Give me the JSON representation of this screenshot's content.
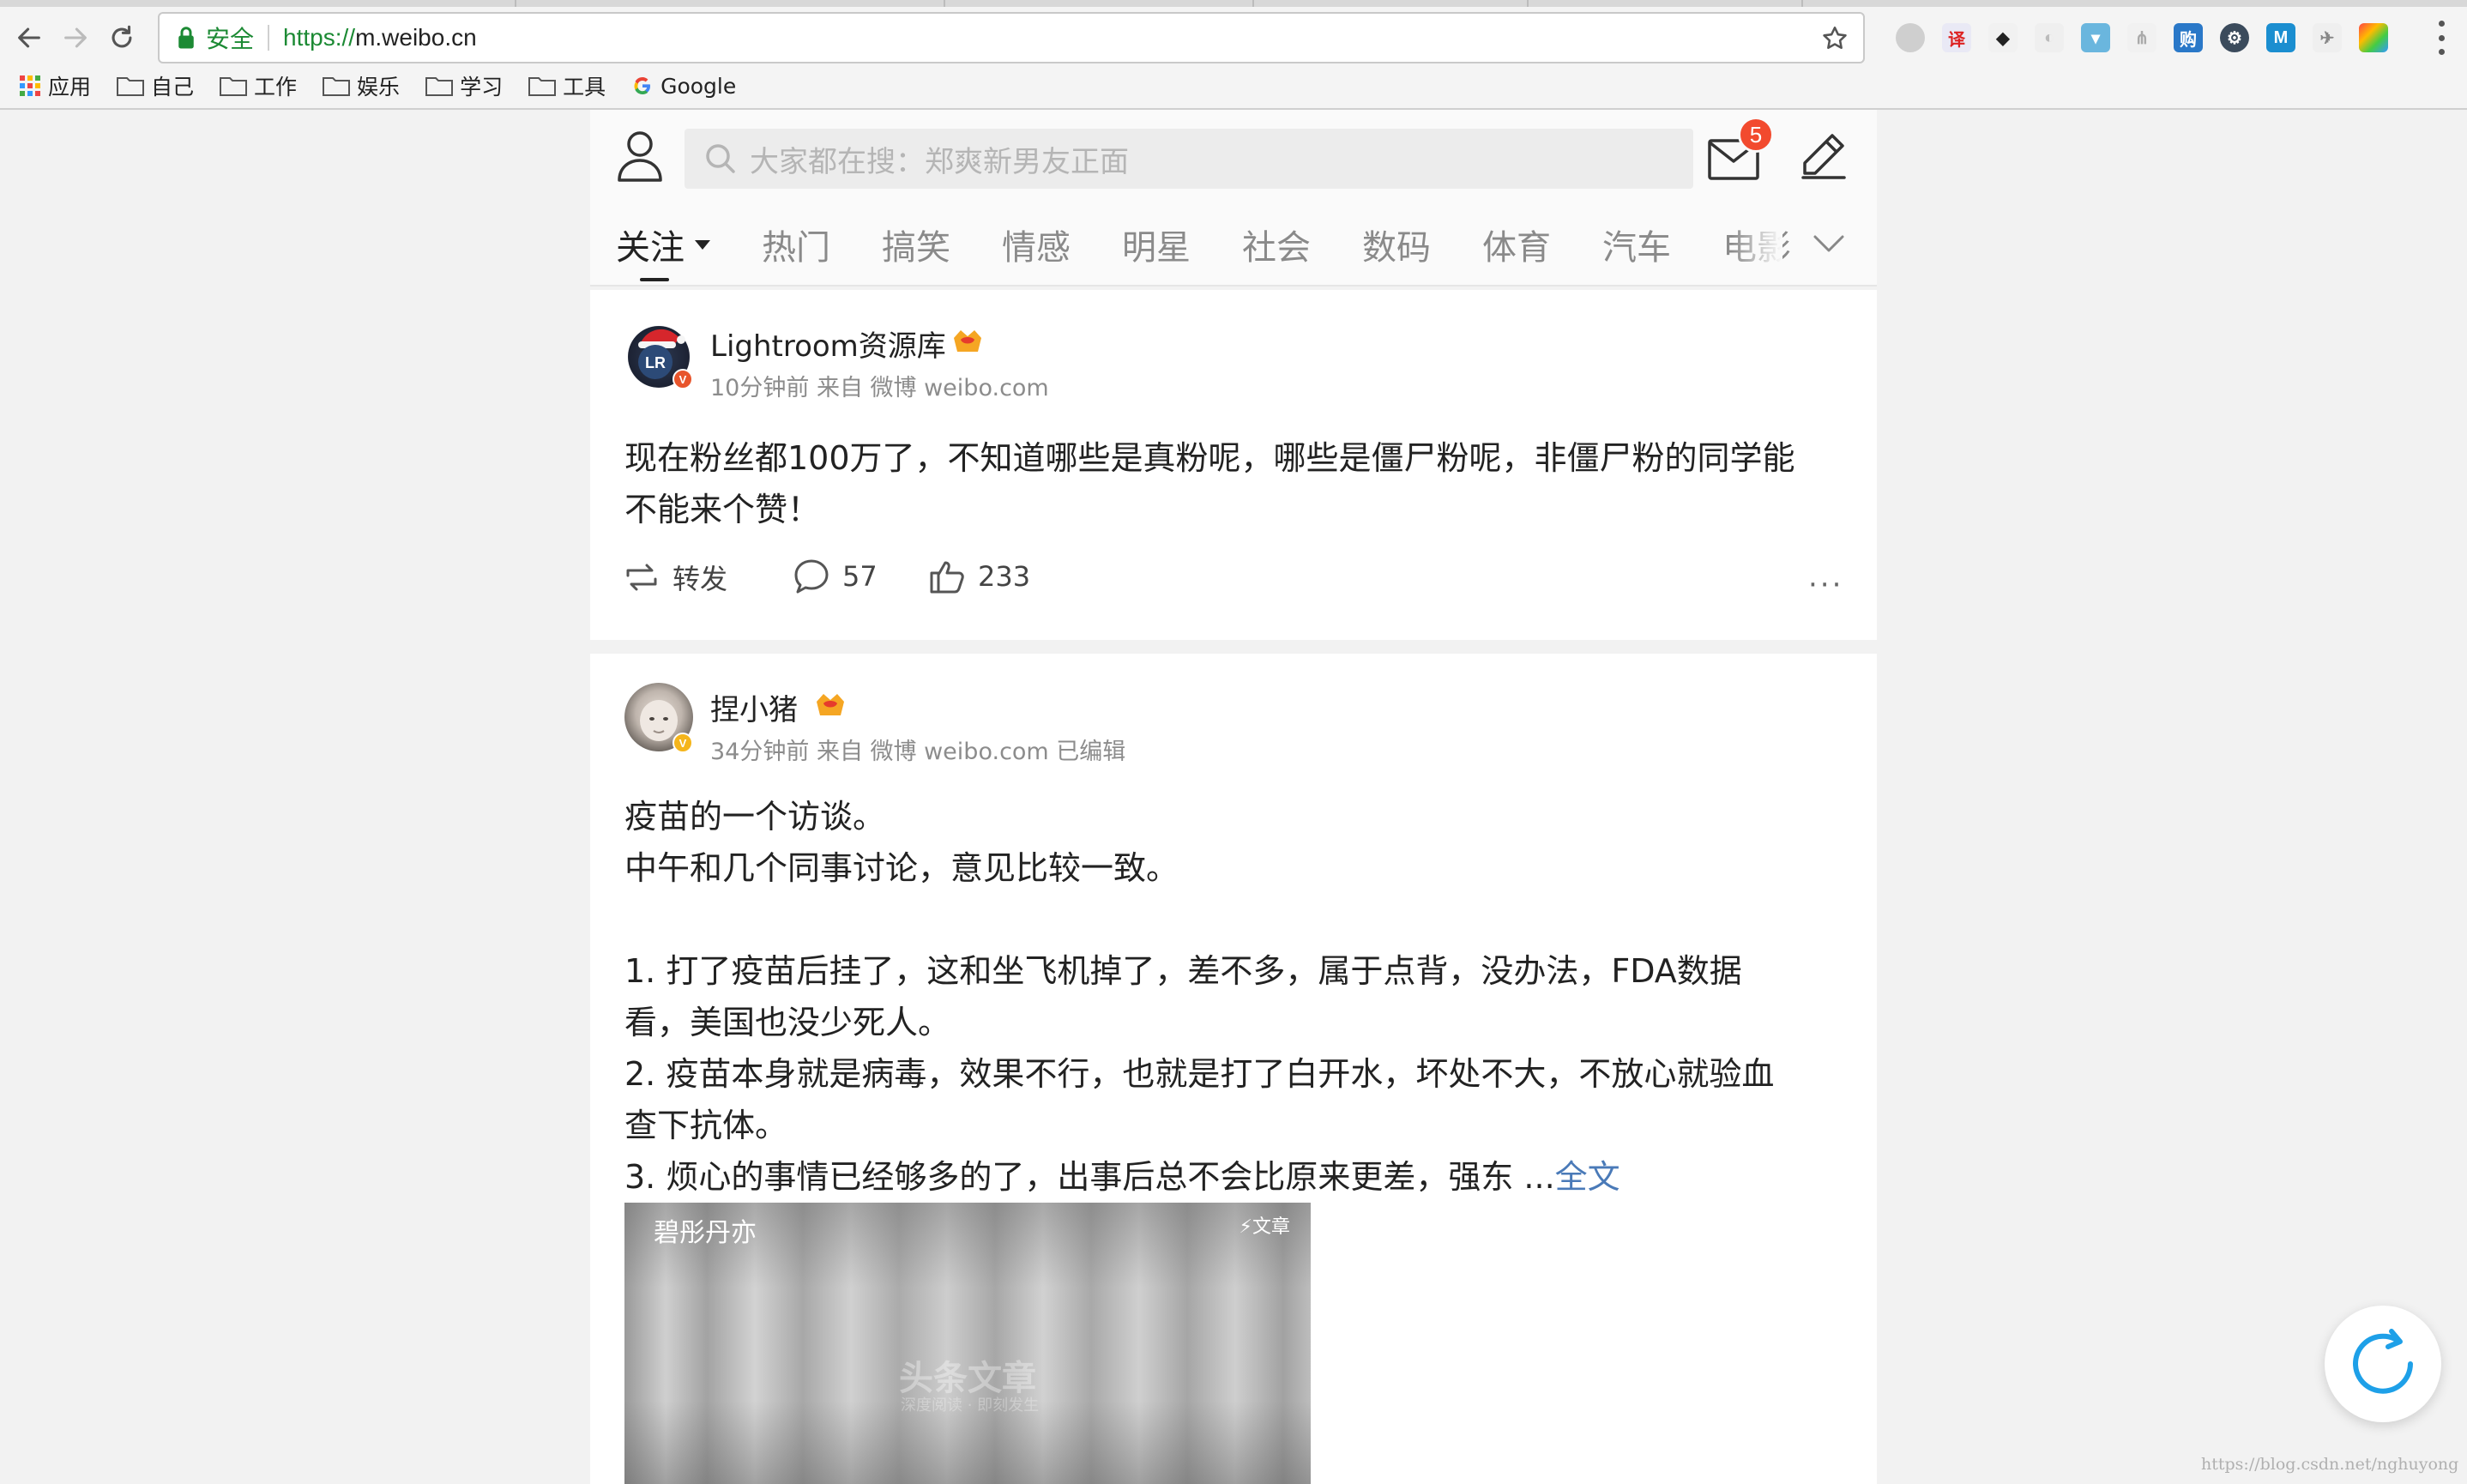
{
  "browser": {
    "secure_label": "安全",
    "url_scheme": "https://",
    "url_host": "m.weibo.cn",
    "bookmarks": [
      {
        "label": "应用",
        "icon": "apps-grid-icon"
      },
      {
        "label": "自己",
        "icon": "folder-icon"
      },
      {
        "label": "工作",
        "icon": "folder-icon"
      },
      {
        "label": "娱乐",
        "icon": "folder-icon"
      },
      {
        "label": "学习",
        "icon": "folder-icon"
      },
      {
        "label": "工具",
        "icon": "folder-icon"
      },
      {
        "label": "Google",
        "icon": "google-g-icon"
      }
    ]
  },
  "header": {
    "search_placeholder": "大家都在搜：郑爽新男友正面",
    "mail_badge": "5"
  },
  "tabs": [
    {
      "label": "关注",
      "active": true
    },
    {
      "label": "热门"
    },
    {
      "label": "搞笑"
    },
    {
      "label": "情感"
    },
    {
      "label": "明星"
    },
    {
      "label": "社会"
    },
    {
      "label": "数码"
    },
    {
      "label": "体育"
    },
    {
      "label": "汽车"
    },
    {
      "label": "电影"
    }
  ],
  "posts": [
    {
      "username": "Lightroom资源库",
      "meta": "10分钟前 来自 微博 weibo.com",
      "avatar_text": "LR",
      "text_lines": [
        "现在粉丝都100万了，不知道哪些是真粉呢，哪些是僵尸粉呢，非僵尸粉的同学能",
        "不能来个赞！"
      ],
      "repost_label": "转发",
      "comments": "57",
      "likes": "233",
      "more": "···"
    },
    {
      "username": "捏小猪",
      "meta": "34分钟前 来自 微博 weibo.com 已编辑",
      "text_lines": [
        "疫苗的一个访谈。",
        "中午和几个同事讨论，意见比较一致。",
        "",
        "1. 打了疫苗后挂了，这和坐飞机掉了，差不多，属于点背，没办法，FDA数据",
        "看，美国也没少死人。",
        "2. 疫苗本身就是病毒，效果不行，也就是打了白开水，坏处不大，不放心就验血",
        "查下抗体。",
        "3. 烦心的事情已经够多的了，出事后总不会比原来更差，强东 ..."
      ],
      "full_text_link": "全文",
      "article": {
        "author": "碧彤丹亦",
        "tag": "文章",
        "watermark": "头条文章",
        "watermark_sub": "深度阅读 · 即刻发生"
      }
    }
  ],
  "watermark": "https://blog.csdn.net/nghuyong",
  "colors": {
    "accent_link": "#4a7ab8",
    "badge": "#f24a2e",
    "refresh": "#1ea0e8",
    "secure_green": "#1c8a34"
  }
}
